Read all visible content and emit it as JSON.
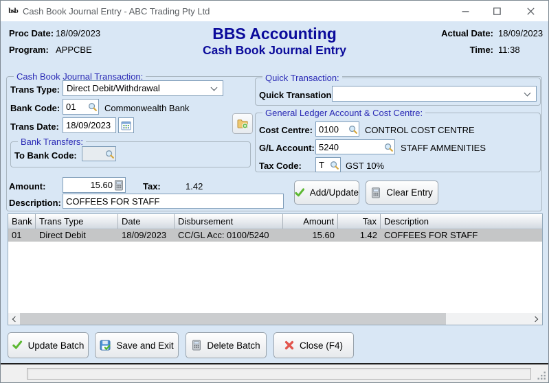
{
  "window": {
    "logo_text": "bsb",
    "title": "Cash Book Journal Entry - ABC Trading Pty Ltd"
  },
  "header": {
    "proc_date_label": "Proc Date:",
    "proc_date_value": "18/09/2023",
    "program_label": "Program:",
    "program_value": "APPCBE",
    "app_title": "BBS Accounting",
    "screen_title": "Cash Book Journal Entry",
    "actual_date_label": "Actual Date:",
    "actual_date_value": "18/09/2023",
    "time_label": "Time:",
    "time_value": "11:38"
  },
  "transaction": {
    "group_label": "Cash Book Journal Transaction:",
    "trans_type_label": "Trans Type:",
    "trans_type_value": "Direct Debit/Withdrawal",
    "bank_code_label": "Bank Code:",
    "bank_code_value": "01",
    "bank_name": "Commonwealth Bank",
    "trans_date_label": "Trans Date:",
    "trans_date_value": "18/09/2023",
    "amount_label": "Amount:",
    "amount_value": "15.60",
    "tax_label": "Tax:",
    "tax_value": "1.42",
    "description_label": "Description:",
    "description_value": "COFFEES FOR STAFF",
    "add_update_button": "Add/Update",
    "clear_entry_button": "Clear Entry"
  },
  "bank_transfers": {
    "group_label": "Bank Transfers:",
    "to_bank_code_label": "To Bank Code:",
    "to_bank_code_value": ""
  },
  "quick_transaction": {
    "group_label": "Quick Transaction:",
    "field_label": "Quick Transation:",
    "value": ""
  },
  "gl_section": {
    "group_label": "General Ledger Account & Cost Centre:",
    "cost_centre_label": "Cost Centre:",
    "cost_centre_value": "0100",
    "cost_centre_desc": "CONTROL COST CENTRE",
    "gl_account_label": "G/L Account:",
    "gl_account_value": "5240",
    "gl_account_desc": "STAFF AMMENITIES",
    "tax_code_label": "Tax Code:",
    "tax_code_value": "T",
    "tax_code_desc": "GST 10%"
  },
  "grid": {
    "columns": [
      "Bank",
      "Trans Type",
      "Date",
      "Disbursement",
      "Amount",
      "Tax",
      "Description"
    ],
    "rows": [
      {
        "bank": "01",
        "trans_type": "Direct Debit",
        "date": "18/09/2023",
        "disbursement": "CC/GL Acc: 0100/5240",
        "amount": "15.60",
        "tax": "1.42",
        "description": "COFFEES FOR STAFF"
      }
    ]
  },
  "footer_buttons": [
    {
      "label": "Update Batch",
      "icon": "green-check"
    },
    {
      "label": "Save and Exit",
      "icon": "save-disk-check"
    },
    {
      "label": "Delete Batch",
      "icon": "gray-calculator"
    },
    {
      "label": "Close (F4)",
      "icon": "red-x"
    }
  ],
  "icons": {
    "lookup": "magnifier",
    "calendar": "date-picker-grid",
    "amount_calc": "mini-calculator",
    "new_batch": "folder-with-plus",
    "add_update": "green-check",
    "clear_entry": "gray-calculator"
  },
  "colors": {
    "client_bg": "#d9e7f5",
    "heading_blue": "#0b0b9b",
    "group_label_blue": "#2a2ab5",
    "input_border": "#7f9db9",
    "selected_row": "#c5c6c7",
    "titlebar_bg": "#ffffff"
  }
}
